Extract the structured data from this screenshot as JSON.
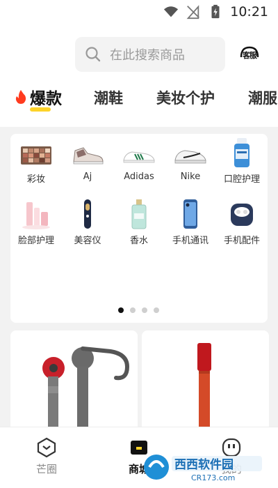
{
  "status_bar": {
    "time": "10:21"
  },
  "header": {
    "search_placeholder": "在此搜索商品",
    "service_label": "客服"
  },
  "tabs": [
    {
      "label": "爆款"
    },
    {
      "label": "潮鞋"
    },
    {
      "label": "美妆个护"
    },
    {
      "label": "潮服"
    }
  ],
  "categories": [
    {
      "label": "彩妆",
      "icon": "eyeshadow-palette-icon"
    },
    {
      "label": "Aj",
      "icon": "sneaker-aj-icon"
    },
    {
      "label": "Adidas",
      "icon": "sneaker-adidas-icon"
    },
    {
      "label": "Nike",
      "icon": "sneaker-nike-icon"
    },
    {
      "label": "口腔护理",
      "icon": "mouthwash-bottle-icon"
    },
    {
      "label": "脸部护理",
      "icon": "skincare-set-icon"
    },
    {
      "label": "美容仪",
      "icon": "beauty-device-icon"
    },
    {
      "label": "香水",
      "icon": "perfume-icon"
    },
    {
      "label": "手机通讯",
      "icon": "smartphone-icon"
    },
    {
      "label": "手机配件",
      "icon": "earbuds-case-icon"
    }
  ],
  "pager": {
    "count": 4,
    "active": 1
  },
  "bottom_nav": [
    {
      "label": "芒圈",
      "icon": "community-icon"
    },
    {
      "label": "商城",
      "icon": "shop-bag-icon"
    },
    {
      "label": "我的",
      "icon": "profile-face-icon"
    }
  ],
  "watermark": {
    "brand": "西西软件园",
    "url": "CR173.com"
  },
  "colors": {
    "accent_yellow": "#fdd32a",
    "fire_red": "#ff3b1f",
    "content_bg": "#f2f2f2"
  }
}
